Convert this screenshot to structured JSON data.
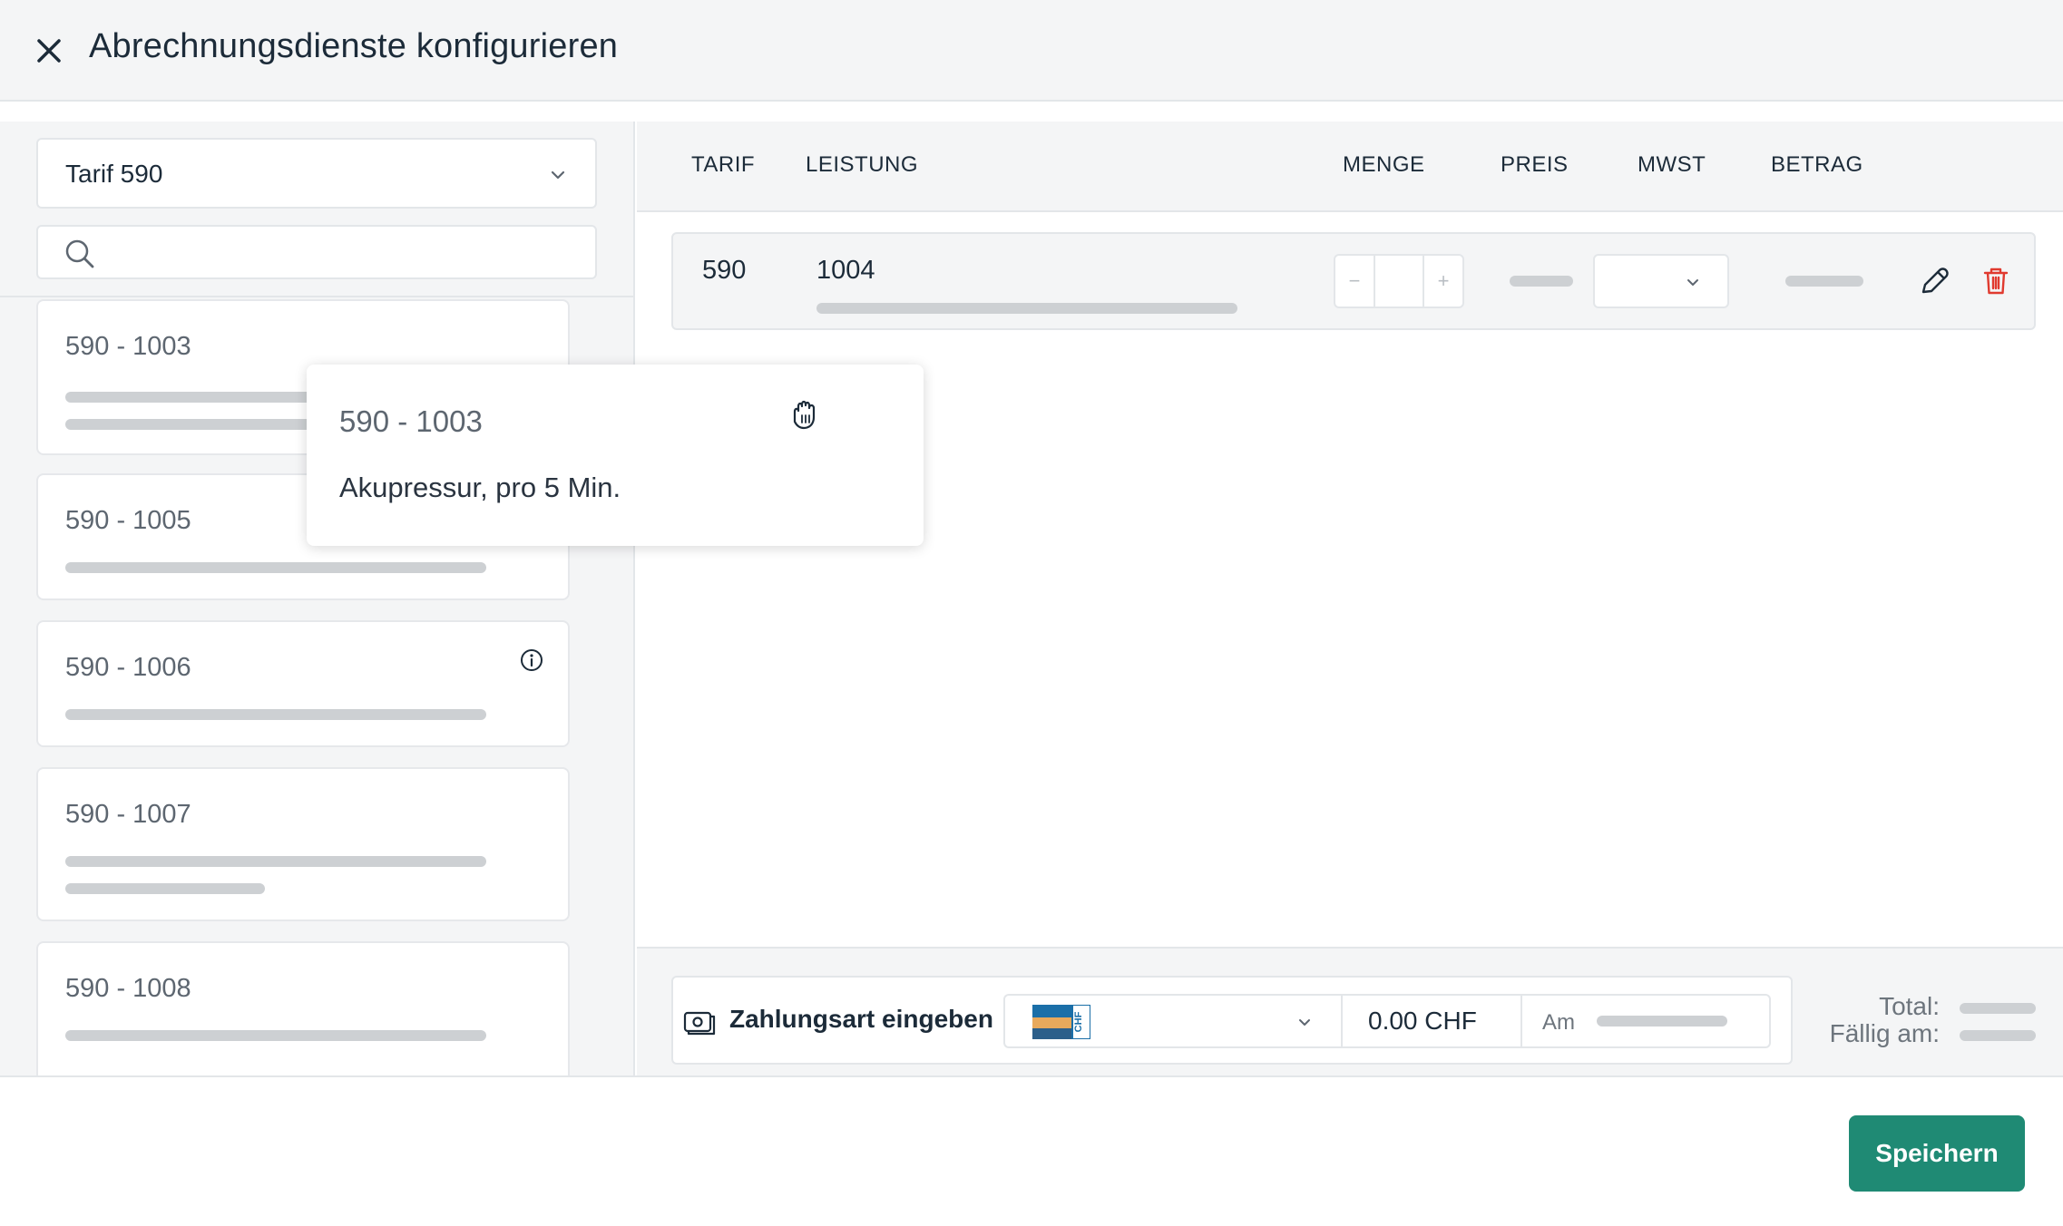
{
  "header": {
    "title": "Abrechnungsdienste konfigurieren",
    "close_icon": "close-icon"
  },
  "left": {
    "tarif_select": {
      "value": "Tarif 590"
    },
    "search": {
      "placeholder": "",
      "value": ""
    },
    "cards": [
      {
        "code": "590 - 1003"
      },
      {
        "code": "590 - 1005"
      },
      {
        "code": "590 - 1006",
        "info_icon": true
      },
      {
        "code": "590 - 1007"
      },
      {
        "code": "590 - 1008"
      }
    ]
  },
  "tooltip": {
    "code": "590 - 1003",
    "description": "Akupressur, pro 5 Min."
  },
  "table": {
    "headers": {
      "tarif": "TARIF",
      "leistung": "LEISTUNG",
      "menge": "MENGE",
      "preis": "PREIS",
      "mwst": "MWST",
      "betrag": "BETRAG"
    },
    "rows": [
      {
        "tarif": "590",
        "leistung": "1004",
        "quantity_minus": "−",
        "quantity_plus": "+",
        "quantity": ""
      }
    ]
  },
  "payment": {
    "label": "Zahlungsart eingeben",
    "card_label": "CHF",
    "amount": "0.00 CHF",
    "date_prefix": "Am"
  },
  "totals": {
    "total_label": "Total:",
    "due_label": "Fällig am:"
  },
  "actions": {
    "save": "Speichern"
  },
  "colors": {
    "accent": "#1f8a74",
    "delete": "#e03a2f"
  }
}
